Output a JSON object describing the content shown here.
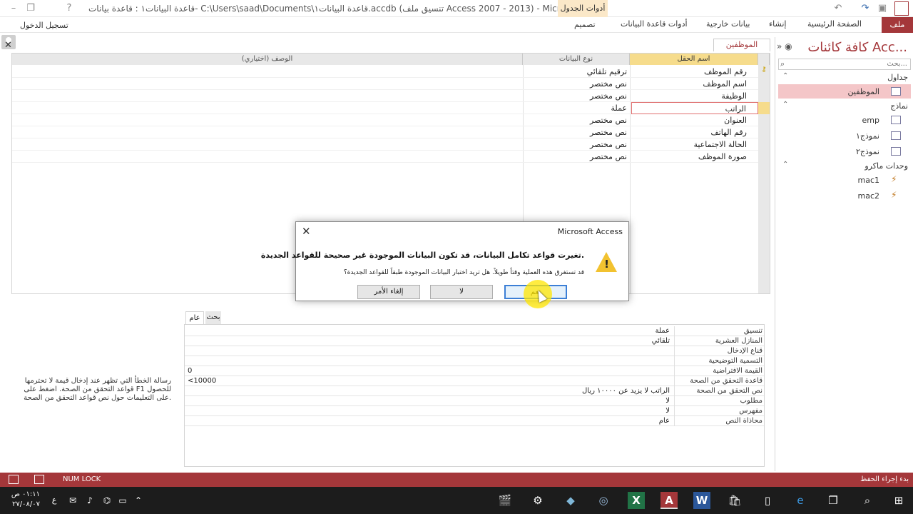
{
  "window": {
    "title": "قاعدة البيانات١ : قاعدة بيانات- C:\\Users\\saad\\Documents\\قاعدة البيانات١.accdb (تنسيق ملف Access 2007 - 2013) - Microsoft Acc...",
    "context_group": "أدوات الجدول"
  },
  "ribbon": {
    "tabs": [
      "ملف",
      "الصفحة الرئيسية",
      "إنشاء",
      "بيانات خارجية",
      "أدوات قاعدة البيانات",
      "تصميم"
    ],
    "sign_in": "تسجيل الدخول"
  },
  "nav_pane": {
    "title": "كافة كائنات Acc...",
    "search_placeholder": "بحث...",
    "groups": [
      {
        "label": "جداول",
        "items": [
          {
            "label": "الموظفين",
            "icon": "table-icon",
            "selected": true
          }
        ]
      },
      {
        "label": "نماذج",
        "items": [
          {
            "label": "emp",
            "icon": "form-icon"
          },
          {
            "label": "نموذج١",
            "icon": "form-icon"
          },
          {
            "label": "نموذج٢",
            "icon": "form-icon"
          }
        ]
      },
      {
        "label": "وحدات ماكرو",
        "items": [
          {
            "label": "mac1",
            "icon": "macro-icon"
          },
          {
            "label": "mac2",
            "icon": "macro-icon"
          }
        ]
      }
    ]
  },
  "document_tab": {
    "label": "الموظفين"
  },
  "design_grid": {
    "headers": {
      "field_name": "اسم الحقل",
      "data_type": "نوع البيانات",
      "description": "الوصف (اختياري)"
    },
    "rows": [
      {
        "name": "رقم الموظف",
        "type": "ترقيم تلقائي",
        "key": true
      },
      {
        "name": "اسم الموظف",
        "type": "نص مختصر"
      },
      {
        "name": "الوظيفة",
        "type": "نص مختصر"
      },
      {
        "name": "الراتب",
        "type": "عملة",
        "current": true
      },
      {
        "name": "العنوان",
        "type": "نص مختصر"
      },
      {
        "name": "رقم الهاتف",
        "type": "نص مختصر"
      },
      {
        "name": "الحالة الاجتماعية",
        "type": "نص مختصر"
      },
      {
        "name": "صورة الموظف",
        "type": "نص مختصر"
      }
    ]
  },
  "properties": {
    "tabs": [
      "عام",
      "بحث"
    ],
    "rows": [
      {
        "label": "تنسيق",
        "value": "عملة"
      },
      {
        "label": "المنازل العشرية",
        "value": "تلقائي"
      },
      {
        "label": "قناع الإدخال",
        "value": ""
      },
      {
        "label": "التسمية التوضيحية",
        "value": ""
      },
      {
        "label": "القيمة الافتراضية",
        "value": "0"
      },
      {
        "label": "قاعدة التحقق من الصحة",
        "value": "<10000"
      },
      {
        "label": "نص التحقق من الصحة",
        "value": "الراتب لا يزيد عن ١٠٠٠٠ ريال"
      },
      {
        "label": "مطلوب",
        "value": "لا"
      },
      {
        "label": "مفهرس",
        "value": "لا"
      },
      {
        "label": "محاذاة النص",
        "value": "عام"
      }
    ],
    "help_text": "رسالة الخطأ التي تظهر عند إدخال قيمة لا تحترمها قواعد التحقق من الصحة. اضغط على F1 للحصول على التعليمات حول نص قواعد التحقق من الصحة."
  },
  "dialog": {
    "title": "Microsoft Access",
    "message_main": "تغيرت قواعد تكامل البيانات، قد تكون البيانات الموجودة غير صحيحة للقواعد الجديدة.",
    "message_sub": "قد تستغرق هذه العملية وقتاً طويلاً. هل تريد اختبار البيانات الموجودة طبقاً للقواعد الجديدة؟",
    "buttons": {
      "yes": "نعم",
      "no": "لا",
      "cancel": "إلغاء الأمر"
    }
  },
  "status_bar": {
    "ready": "بدء إجراء الحفظ",
    "num_lock": "NUM LOCK"
  },
  "taskbar": {
    "time": "٠١:١١ ص",
    "date": "٢٧/٠٨/٠٧",
    "lang": "ع"
  }
}
